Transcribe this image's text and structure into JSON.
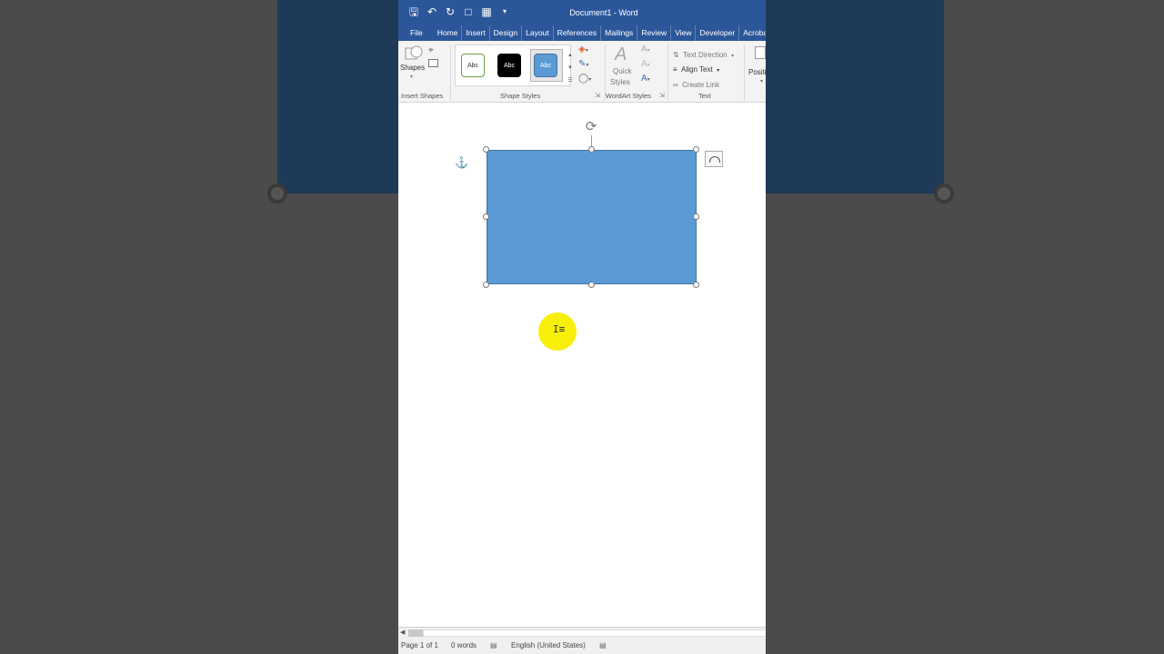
{
  "window": {
    "title": "Document1 - Word"
  },
  "qat": {
    "save_icon": "save-icon",
    "undo_icon": "undo-icon",
    "redo_icon": "redo-icon",
    "new_doc_icon": "new-document-icon",
    "customize_icon": "customize-qat-icon"
  },
  "tabs": [
    "File",
    "Home",
    "Insert",
    "Design",
    "Layout",
    "References",
    "Mailings",
    "Review",
    "View",
    "Developer",
    "Acrobat"
  ],
  "ribbon": {
    "insert_shapes": {
      "shapes_label": "Shapes",
      "group_label": "Insert Shapes"
    },
    "shape_styles": {
      "style1": "Abc",
      "style2": "Abc",
      "style3": "Abc",
      "group_label": "Shape Styles"
    },
    "wordart_styles": {
      "quick_styles_line1": "Quick",
      "quick_styles_line2": "Styles",
      "group_label": "WordArt Styles"
    },
    "text": {
      "text_direction": "Text Direction",
      "align_text": "Align Text",
      "create_link": "Create Link",
      "group_label": "Text"
    },
    "arrange": {
      "position_label": "Positi"
    }
  },
  "status": {
    "page": "Page 1 of 1",
    "words": "0 words",
    "language": "English (United States)"
  },
  "colors": {
    "title_bar": "#2b579a",
    "shape_fill": "#5b9bd5",
    "shape_border": "#41719c",
    "cursor_highlight": "#f7ef0a"
  }
}
